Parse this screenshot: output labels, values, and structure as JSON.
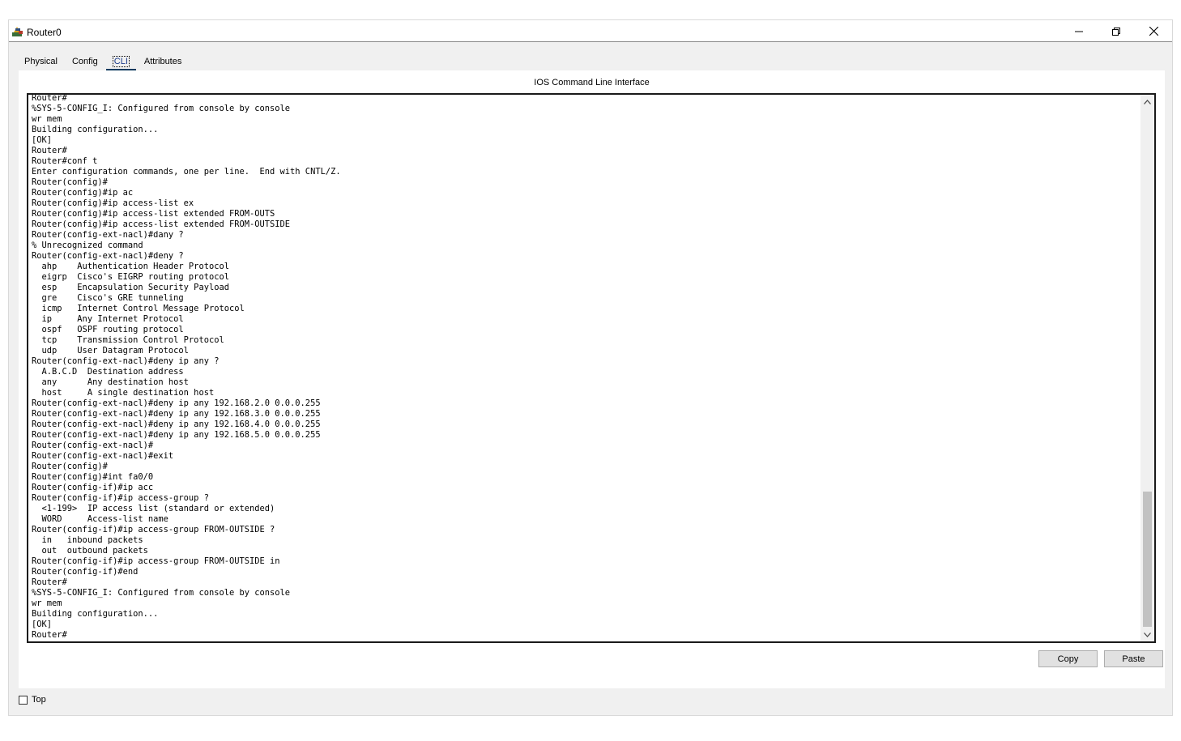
{
  "window": {
    "title": "Router0"
  },
  "tabs": [
    {
      "label": "Physical",
      "active": false
    },
    {
      "label": "Config",
      "active": false
    },
    {
      "label": "CLI",
      "active": true
    },
    {
      "label": "Attributes",
      "active": false
    }
  ],
  "cli": {
    "heading": "IOS Command Line Interface",
    "output": "Router#\n%SYS-5-CONFIG_I: Configured from console by console\nwr mem\nBuilding configuration...\n[OK]\nRouter#\nRouter#conf t\nEnter configuration commands, one per line.  End with CNTL/Z.\nRouter(config)#\nRouter(config)#ip ac\nRouter(config)#ip access-list ex\nRouter(config)#ip access-list extended FROM-OUTS\nRouter(config)#ip access-list extended FROM-OUTSIDE\nRouter(config-ext-nacl)#dany ?\n% Unrecognized command\nRouter(config-ext-nacl)#deny ?\n  ahp    Authentication Header Protocol\n  eigrp  Cisco's EIGRP routing protocol\n  esp    Encapsulation Security Payload\n  gre    Cisco's GRE tunneling\n  icmp   Internet Control Message Protocol\n  ip     Any Internet Protocol\n  ospf   OSPF routing protocol\n  tcp    Transmission Control Protocol\n  udp    User Datagram Protocol\nRouter(config-ext-nacl)#deny ip any ?\n  A.B.C.D  Destination address\n  any      Any destination host\n  host     A single destination host\nRouter(config-ext-nacl)#deny ip any 192.168.2.0 0.0.0.255\nRouter(config-ext-nacl)#deny ip any 192.168.3.0 0.0.0.255\nRouter(config-ext-nacl)#deny ip any 192.168.4.0 0.0.0.255\nRouter(config-ext-nacl)#deny ip any 192.168.5.0 0.0.0.255\nRouter(config-ext-nacl)#\nRouter(config-ext-nacl)#exit\nRouter(config)#\nRouter(config)#int fa0/0\nRouter(config-if)#ip acc\nRouter(config-if)#ip access-group ?\n  <1-199>  IP access list (standard or extended)\n  WORD     Access-list name\nRouter(config-if)#ip access-group FROM-OUTSIDE ?\n  in   inbound packets\n  out  outbound packets\nRouter(config-if)#ip access-group FROM-OUTSIDE in\nRouter(config-if)#end\nRouter#\n%SYS-5-CONFIG_I: Configured from console by console\nwr mem\nBuilding configuration...\n[OK]\nRouter#"
  },
  "buttons": {
    "copy": "Copy",
    "paste": "Paste"
  },
  "footer": {
    "top_label": "Top",
    "top_checked": false
  },
  "icons": {
    "minimize": "minimize-icon",
    "restore": "restore-icon",
    "close": "close-icon"
  }
}
